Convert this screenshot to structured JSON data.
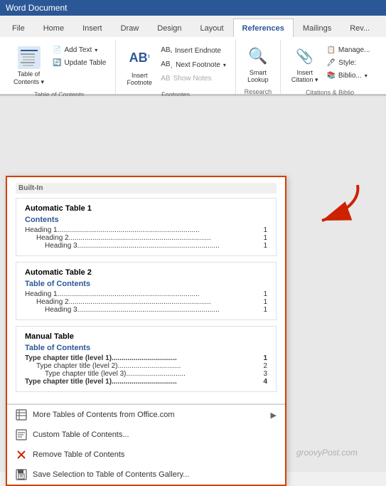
{
  "titlebar": {
    "label": "Word Document"
  },
  "tabs": [
    {
      "id": "file",
      "label": "File"
    },
    {
      "id": "home",
      "label": "Home"
    },
    {
      "id": "insert",
      "label": "Insert"
    },
    {
      "id": "draw",
      "label": "Draw"
    },
    {
      "id": "design",
      "label": "Design"
    },
    {
      "id": "layout",
      "label": "Layout"
    },
    {
      "id": "references",
      "label": "References"
    },
    {
      "id": "mailings",
      "label": "Mailings"
    },
    {
      "id": "review",
      "label": "Rev..."
    }
  ],
  "active_tab": "references",
  "ribbon": {
    "groups": [
      {
        "id": "toc",
        "label": "Table of Contents",
        "buttons": [
          {
            "id": "toc-btn",
            "label": "Table of\nContents",
            "icon": "📋"
          },
          {
            "id": "add-text",
            "label": "Add Text"
          },
          {
            "id": "update-table",
            "label": "Update Table"
          }
        ]
      },
      {
        "id": "footnotes",
        "label": "Footnotes",
        "buttons": [
          {
            "id": "insert-footnote",
            "label": "Insert\nFootnote",
            "icon": "AB"
          },
          {
            "id": "insert-endnote",
            "label": "Insert Endnote"
          },
          {
            "id": "next-footnote",
            "label": "Next Footnote"
          },
          {
            "id": "show-notes",
            "label": "Show Notes"
          }
        ]
      },
      {
        "id": "research",
        "label": "Research",
        "buttons": [
          {
            "id": "smart-lookup",
            "label": "Smart\nLookup",
            "icon": "🔍"
          }
        ]
      },
      {
        "id": "citations",
        "label": "Citations & Biblio",
        "buttons": [
          {
            "id": "insert-citation",
            "label": "Insert\nCitation",
            "icon": "📎"
          },
          {
            "id": "manage",
            "label": "Manage..."
          },
          {
            "id": "style",
            "label": "Style:"
          },
          {
            "id": "bibliography",
            "label": "Biblio..."
          }
        ]
      }
    ]
  },
  "dropdown": {
    "section_title": "Built-In",
    "tables": [
      {
        "id": "auto-table-1",
        "title": "Automatic Table 1",
        "contents_title": "Contents",
        "rows": [
          {
            "label": "Heading 1",
            "page": "1",
            "indent": 0
          },
          {
            "label": "Heading 2",
            "page": "1",
            "indent": 1
          },
          {
            "label": "Heading 3",
            "page": "1",
            "indent": 2
          }
        ]
      },
      {
        "id": "auto-table-2",
        "title": "Automatic Table 2",
        "contents_title": "Table of Contents",
        "rows": [
          {
            "label": "Heading 1",
            "page": "1",
            "indent": 0
          },
          {
            "label": "Heading 2",
            "page": "1",
            "indent": 1
          },
          {
            "label": "Heading 3",
            "page": "1",
            "indent": 2
          }
        ]
      },
      {
        "id": "manual-table",
        "title": "Manual Table",
        "contents_title": "Table of Contents",
        "rows": [
          {
            "label": "Type chapter title (level 1)",
            "page": "1",
            "indent": 0,
            "bold": true
          },
          {
            "label": "Type chapter title (level 2)",
            "page": "2",
            "indent": 1
          },
          {
            "label": "Type chapter title (level 3)",
            "page": "3",
            "indent": 2
          },
          {
            "label": "Type chapter title (level 1)",
            "page": "4",
            "indent": 0,
            "bold": true
          }
        ]
      }
    ],
    "menu_items": [
      {
        "id": "more-tables",
        "label": "More Tables of Contents from Office.com",
        "has_arrow": true
      },
      {
        "id": "custom-toc",
        "label": "Custom Table of Contents...",
        "has_arrow": false
      },
      {
        "id": "remove-toc",
        "label": "Remove Table of Contents",
        "has_arrow": false
      },
      {
        "id": "save-selection",
        "label": "Save Selection to Table of Contents Gallery...",
        "has_arrow": false
      }
    ]
  },
  "watermark": "groovyPost.com",
  "arrow": {
    "color": "#cc2200"
  }
}
